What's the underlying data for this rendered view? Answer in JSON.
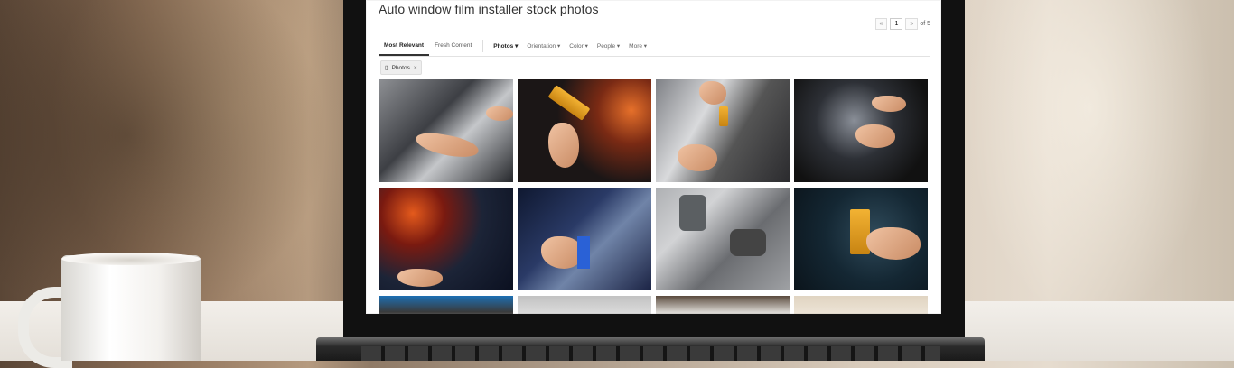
{
  "page": {
    "title": "Auto window film installer stock photos"
  },
  "pagination": {
    "prev_label": "«",
    "current_page": "1",
    "next_label": "»",
    "of_label": "of 5"
  },
  "tabs": [
    {
      "label": "Most Relevant",
      "active": true
    },
    {
      "label": "Fresh Content",
      "active": false
    }
  ],
  "filters": [
    {
      "label": "Photos ▾"
    },
    {
      "label": "Orientation ▾"
    },
    {
      "label": "Color ▾"
    },
    {
      "label": "People ▾"
    },
    {
      "label": "More ▾"
    }
  ],
  "active_filter_chip": {
    "label": "Photos",
    "remove_label": "×"
  },
  "photos_grid_rows": 3,
  "icons": [
    "photo-icon",
    "close-icon"
  ],
  "colors": {
    "squeegee": "#f2b233",
    "page_bg": "#ffffff"
  }
}
